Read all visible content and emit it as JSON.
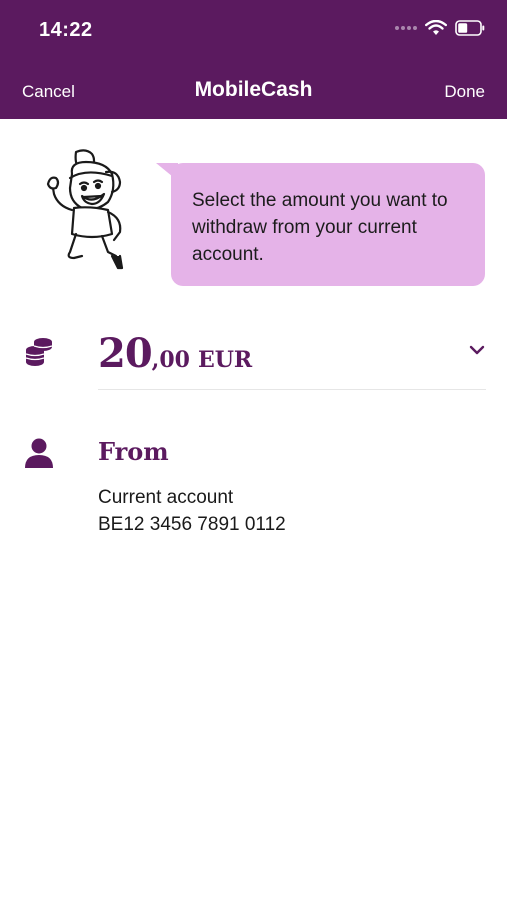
{
  "status_bar": {
    "time": "14:22"
  },
  "nav": {
    "cancel_label": "Cancel",
    "title": "MobileCash",
    "done_label": "Done"
  },
  "message": {
    "text": "Select the amount you want to withdraw from your current account."
  },
  "amount": {
    "whole": "20",
    "decimal": ",00",
    "currency": "EUR"
  },
  "from": {
    "label": "From",
    "account_name": "Current account",
    "iban": "BE12 3456 7891 0112"
  },
  "colors": {
    "brand": "#5b1a5f",
    "bubble": "#e5b3e8"
  },
  "icons": [
    "signal-icon",
    "wifi-icon",
    "battery-icon",
    "mascot-illustration",
    "coins-icon",
    "chevron-down-icon",
    "user-icon"
  ]
}
